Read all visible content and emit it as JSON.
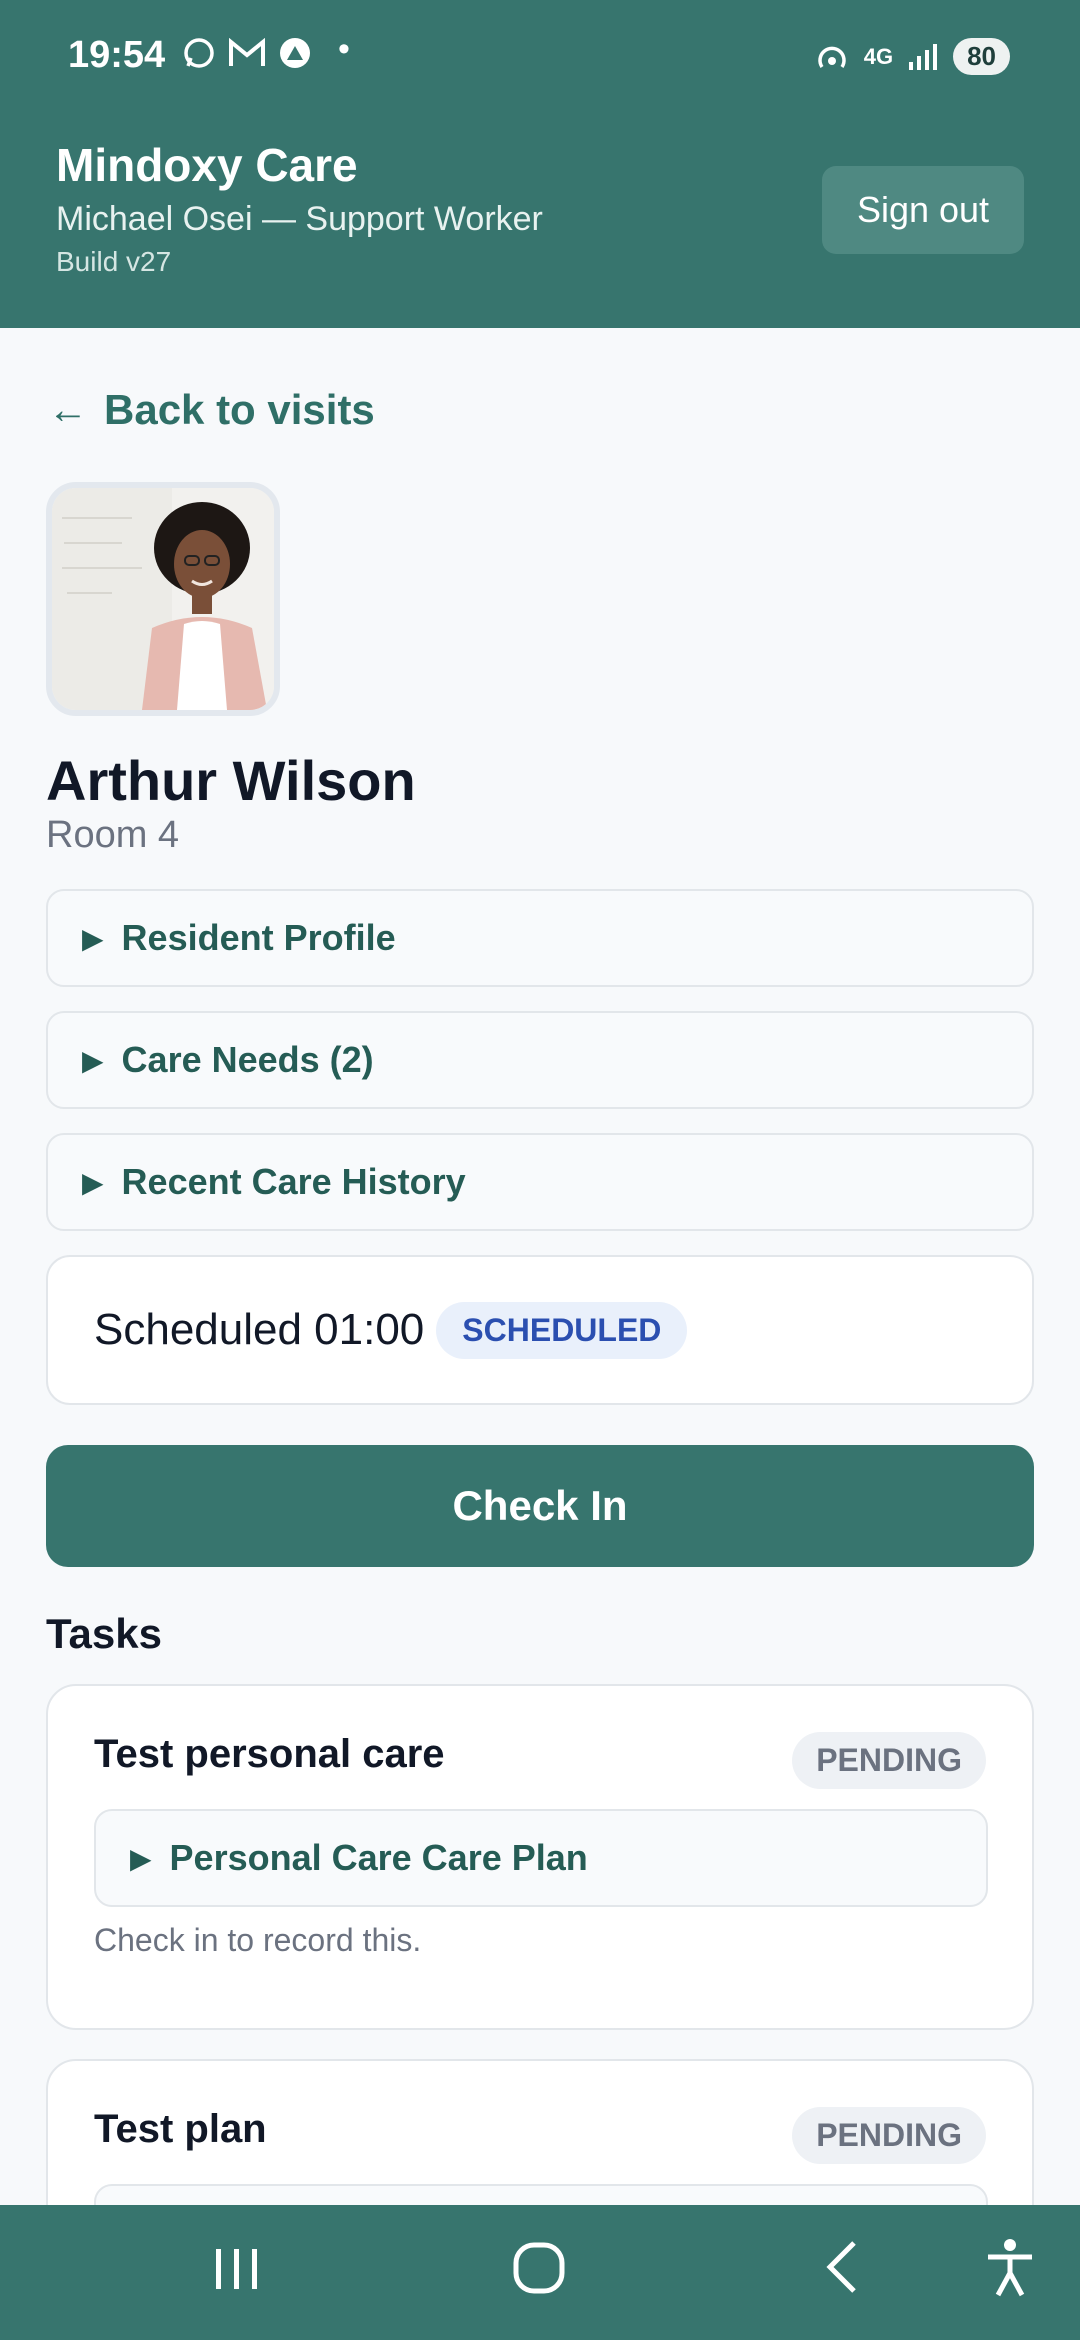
{
  "status_bar": {
    "time": "19:54",
    "network": "4G",
    "battery": "80"
  },
  "header": {
    "title": "Mindoxy Care",
    "user": "Michael Osei — Support Worker",
    "build": "Build v27",
    "sign_out_label": "Sign out"
  },
  "navigation": {
    "back_label": "Back to visits",
    "back_arrow": "←"
  },
  "resident": {
    "name": "Arthur Wilson",
    "room": "Room 4"
  },
  "sections": [
    {
      "label": "Resident Profile"
    },
    {
      "label": "Care Needs (2)"
    },
    {
      "label": "Recent Care History"
    }
  ],
  "schedule": {
    "text": "Scheduled 01:00",
    "status": "SCHEDULED"
  },
  "check_in_label": "Check In",
  "tasks_heading": "Tasks",
  "tasks": [
    {
      "title": "Test personal care",
      "status": "PENDING",
      "care_plan": "Personal Care Care Plan",
      "note": "Check in to record this."
    },
    {
      "title": "Test plan",
      "status": "PENDING"
    }
  ],
  "colors": {
    "primary": "#37756e",
    "link": "#2f6f67",
    "scheduled_badge_text": "#2b4fb0",
    "background": "#f7f9fb"
  },
  "icons": {
    "nav": [
      "recent-apps-icon",
      "home-icon",
      "back-icon",
      "accessibility-icon"
    ]
  }
}
